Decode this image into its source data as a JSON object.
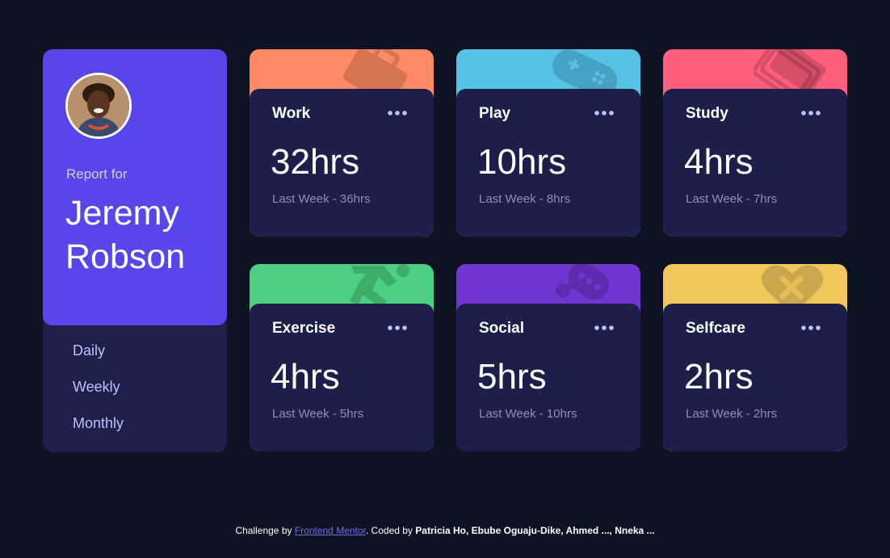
{
  "profile": {
    "report_label": "Report for",
    "name_line1": "Jeremy",
    "name_line2": "Robson"
  },
  "periods": [
    {
      "label": "Daily"
    },
    {
      "label": "Weekly"
    },
    {
      "label": "Monthly"
    }
  ],
  "cards": [
    {
      "title": "Work",
      "current": "32hrs",
      "previous": "Last Week - 36hrs",
      "color": "#ff8b64",
      "icon": "briefcase-icon"
    },
    {
      "title": "Play",
      "current": "10hrs",
      "previous": "Last Week - 8hrs",
      "color": "#55c2e6",
      "icon": "gamepad-icon"
    },
    {
      "title": "Study",
      "current": "4hrs",
      "previous": "Last Week - 7hrs",
      "color": "#ff5e7d",
      "icon": "books-icon"
    },
    {
      "title": "Exercise",
      "current": "4hrs",
      "previous": "Last Week - 5hrs",
      "color": "#4bcf82",
      "icon": "runner-icon"
    },
    {
      "title": "Social",
      "current": "5hrs",
      "previous": "Last Week - 10hrs",
      "color": "#7335d2",
      "icon": "chat-icon"
    },
    {
      "title": "Selfcare",
      "current": "2hrs",
      "previous": "Last Week - 2hrs",
      "color": "#f1c75b",
      "icon": "heart-icon"
    }
  ],
  "footer": {
    "prefix": "Challenge by ",
    "link_text": "Frontend Mentor",
    "middle": ". Coded by ",
    "authors": "Patricia Ho, Ebube Oguaju-Dike, Ahmed ..., Nneka ..."
  },
  "colors": {
    "background": "#0e1323",
    "profile_accent": "#5747ea",
    "card_body": "#1c1f4a",
    "period_text": "#bdc1ff",
    "muted_text": "#8b8fba"
  }
}
